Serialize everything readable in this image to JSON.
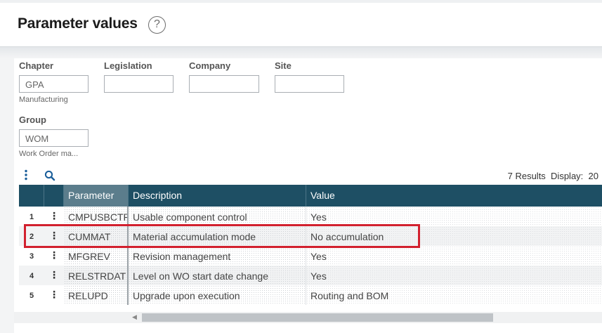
{
  "page": {
    "title": "Parameter values"
  },
  "filters": {
    "chapter": {
      "label": "Chapter",
      "value": "GPA",
      "description": "Manufacturing"
    },
    "legislation": {
      "label": "Legislation",
      "value": ""
    },
    "company": {
      "label": "Company",
      "value": ""
    },
    "site": {
      "label": "Site",
      "value": ""
    },
    "group": {
      "label": "Group",
      "value": "WOM",
      "description": "Work Order ma..."
    }
  },
  "toolbar": {
    "menu_icon": "vertical-ellipsis-icon",
    "search_icon": "search-icon"
  },
  "results": {
    "count_text": "7 Results",
    "display_label": "Display:",
    "display_value": "20"
  },
  "grid": {
    "columns": {
      "parameter": "Parameter",
      "description": "Description",
      "value": "Value"
    },
    "rows": [
      {
        "num": "1",
        "parameter": "CMPUSBCTRL",
        "description": "Usable component control",
        "value": "Yes"
      },
      {
        "num": "2",
        "parameter": "CUMMAT",
        "description": "Material accumulation mode",
        "value": "No accumulation"
      },
      {
        "num": "3",
        "parameter": "MFGREV",
        "description": "Revision management",
        "value": "Yes"
      },
      {
        "num": "4",
        "parameter": "RELSTRDAT",
        "description": "Level on WO start date change",
        "value": "Yes"
      },
      {
        "num": "5",
        "parameter": "RELUPD",
        "description": "Upgrade upon execution",
        "value": "Routing and BOM"
      }
    ],
    "highlighted_row": "2"
  },
  "colors": {
    "header_bg": "#1e4f64",
    "highlight": "#d2202e",
    "accent": "#1a5e9a"
  }
}
